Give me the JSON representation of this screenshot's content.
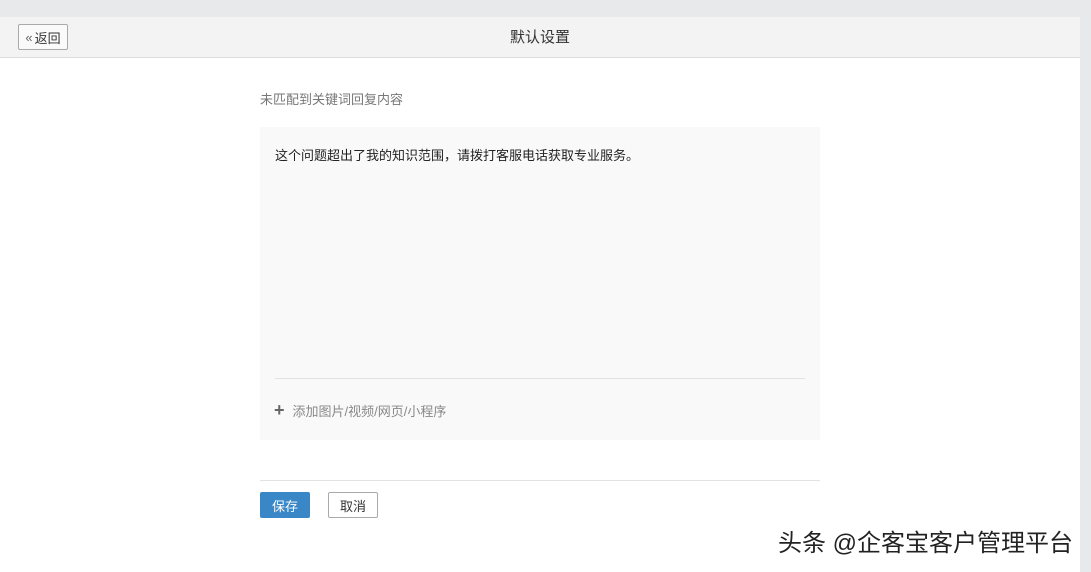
{
  "header": {
    "back_label": "返回",
    "back_icon": "double-chevron-left",
    "title": "默认设置"
  },
  "form": {
    "label": "未匹配到关键词回复内容",
    "reply_text": "这个问题超出了我的知识范围，请拨打客服电话获取专业服务。",
    "add_media_label": "添加图片/视频/网页/小程序"
  },
  "actions": {
    "save_label": "保存",
    "cancel_label": "取消"
  },
  "watermark": "头条 @企客宝客户管理平台",
  "colors": {
    "primary": "#3a87c8"
  }
}
